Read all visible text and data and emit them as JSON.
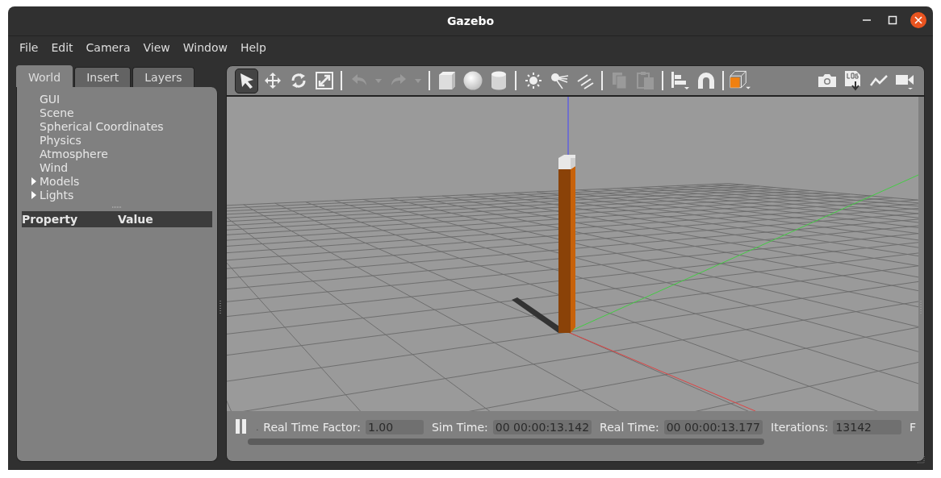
{
  "window": {
    "title": "Gazebo"
  },
  "menu": [
    "File",
    "Edit",
    "Camera",
    "View",
    "Window",
    "Help"
  ],
  "tabs": [
    {
      "label": "World",
      "selected": true
    },
    {
      "label": "Insert",
      "selected": false
    },
    {
      "label": "Layers",
      "selected": false
    }
  ],
  "tree": [
    {
      "label": "GUI",
      "kind": "leaf"
    },
    {
      "label": "Scene",
      "kind": "leaf"
    },
    {
      "label": "Spherical Coordinates",
      "kind": "leaf"
    },
    {
      "label": "Physics",
      "kind": "leaf"
    },
    {
      "label": "Atmosphere",
      "kind": "leaf"
    },
    {
      "label": "Wind",
      "kind": "leaf"
    },
    {
      "label": "Models",
      "kind": "group",
      "expanded": false
    },
    {
      "label": "Lights",
      "kind": "group",
      "expanded": false
    }
  ],
  "property_table": {
    "columns": [
      "Property",
      "Value"
    ]
  },
  "toolbar": [
    {
      "kind": "select",
      "selected": true,
      "disabled": false
    },
    {
      "kind": "translate",
      "selected": false,
      "disabled": false
    },
    {
      "kind": "rotate",
      "selected": false,
      "disabled": false
    },
    {
      "kind": "scale",
      "selected": false,
      "disabled": false
    },
    {
      "kind": "sep"
    },
    {
      "kind": "undo",
      "selected": false,
      "disabled": true
    },
    {
      "kind": "dropdown",
      "selected": false,
      "disabled": true
    },
    {
      "kind": "redo",
      "selected": false,
      "disabled": true
    },
    {
      "kind": "dropdown",
      "selected": false,
      "disabled": true
    },
    {
      "kind": "sep"
    },
    {
      "kind": "box",
      "selected": false,
      "disabled": false
    },
    {
      "kind": "sphere",
      "selected": false,
      "disabled": false
    },
    {
      "kind": "cylinder",
      "selected": false,
      "disabled": false
    },
    {
      "kind": "sep"
    },
    {
      "kind": "pointlight",
      "selected": false,
      "disabled": false
    },
    {
      "kind": "spotlight",
      "selected": false,
      "disabled": false
    },
    {
      "kind": "dirlight",
      "selected": false,
      "disabled": false
    },
    {
      "kind": "sep"
    },
    {
      "kind": "copy",
      "selected": false,
      "disabled": true
    },
    {
      "kind": "paste",
      "selected": false,
      "disabled": true
    },
    {
      "kind": "sep"
    },
    {
      "kind": "align",
      "selected": false,
      "disabled": false
    },
    {
      "kind": "snap",
      "selected": false,
      "disabled": false
    },
    {
      "kind": "sep"
    },
    {
      "kind": "view",
      "selected": false,
      "disabled": false
    },
    {
      "kind": "spacer"
    },
    {
      "kind": "camera",
      "selected": false,
      "disabled": false
    },
    {
      "kind": "log",
      "selected": false,
      "disabled": false
    },
    {
      "kind": "plot",
      "selected": false,
      "disabled": false
    },
    {
      "kind": "video",
      "selected": false,
      "disabled": false
    }
  ],
  "status_bar": {
    "paused": false,
    "step_label": ".",
    "fields": [
      {
        "label": "Real Time Factor:",
        "value": "1.00"
      },
      {
        "label": "Sim Time:",
        "value": "00 00:00:13.142"
      },
      {
        "label": "Real Time:",
        "value": "00 00:00:13.177"
      },
      {
        "label": "Iterations:",
        "value": "13142"
      }
    ],
    "cut_label": "F"
  }
}
